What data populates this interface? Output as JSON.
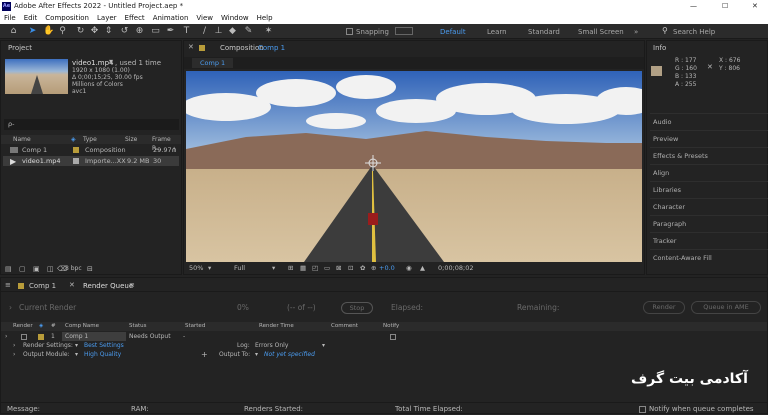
{
  "window": {
    "title": "Adobe After Effects 2022 - Untitled Project.aep *",
    "controls": {
      "minimize": "—",
      "maximize": "☐",
      "close": "✕"
    }
  },
  "menu": [
    "File",
    "Edit",
    "Composition",
    "Layer",
    "Effect",
    "Animation",
    "View",
    "Window",
    "Help"
  ],
  "toolbar": {
    "snapping": "Snapping",
    "workspaces": [
      "Default",
      "Learn",
      "Standard",
      "Small Screen"
    ],
    "search": "Search Help"
  },
  "project": {
    "title": "Project",
    "file_name": "video1.mp4",
    "used": ", used 1 time",
    "meta": [
      "1920 x 1080 (1.00)",
      "Δ 0;00;15;25, 30.00 fps",
      "Millions of Colors",
      "avc1"
    ],
    "search_placeholder": "ρ-",
    "columns": [
      "Name",
      "Type",
      "Size",
      "Frame R..."
    ],
    "items": [
      {
        "name": "Comp 1",
        "type": "Composition",
        "size": "",
        "fps": "29.97"
      },
      {
        "name": "video1.mp4",
        "type": "Importe...XX",
        "size": "9.2 MB",
        "fps": "30"
      }
    ],
    "bpc": "8 bpc"
  },
  "comp": {
    "title": "Composition",
    "name": "Comp 1",
    "tab": "Comp 1",
    "zoom": "50%",
    "resolution": "Full",
    "exposure": "+0.0",
    "timecode": "0;00;08;02"
  },
  "info": {
    "title": "Info",
    "r": "R :  177",
    "g": "G :  160",
    "b": "B :  133",
    "a": "A :  255",
    "x": "X :  676",
    "y": "Y :  806",
    "color": "#b1a085"
  },
  "right_panels": [
    "Audio",
    "Preview",
    "Effects & Presets",
    "Align",
    "Libraries",
    "Character",
    "Paragraph",
    "Tracker",
    "Content-Aware Fill"
  ],
  "bottom_tabs": [
    "Comp 1",
    "Render Queue"
  ],
  "render": {
    "current_render": "Current Render",
    "percent": "0%",
    "of": "(-- of --)",
    "stop": "Stop",
    "elapsed": "Elapsed:",
    "remaining": "Remaining:",
    "render_btn": "Render",
    "queue_ame": "Queue in AME",
    "columns": [
      "Render",
      "#",
      "Comp Name",
      "Status",
      "Started",
      "Render Time",
      "Comment",
      "Notify"
    ],
    "item": {
      "num": "1",
      "comp": "Comp 1",
      "status": "Needs Output",
      "started": "-"
    },
    "render_settings_label": "Render Settings:",
    "render_settings": "Best Settings",
    "log_label": "Log:",
    "log": "Errors Only",
    "output_module_label": "Output Module:",
    "output_module": "High Quality",
    "output_to_label": "Output To:",
    "output_to": "Not yet specified"
  },
  "watermark": "آکادمی بیت گرف",
  "status": {
    "message": "Message:",
    "ram": "RAM:",
    "renders_started": "Renders Started:",
    "total_elapsed": "Total Time Elapsed:",
    "notify": "Notify when queue completes"
  }
}
